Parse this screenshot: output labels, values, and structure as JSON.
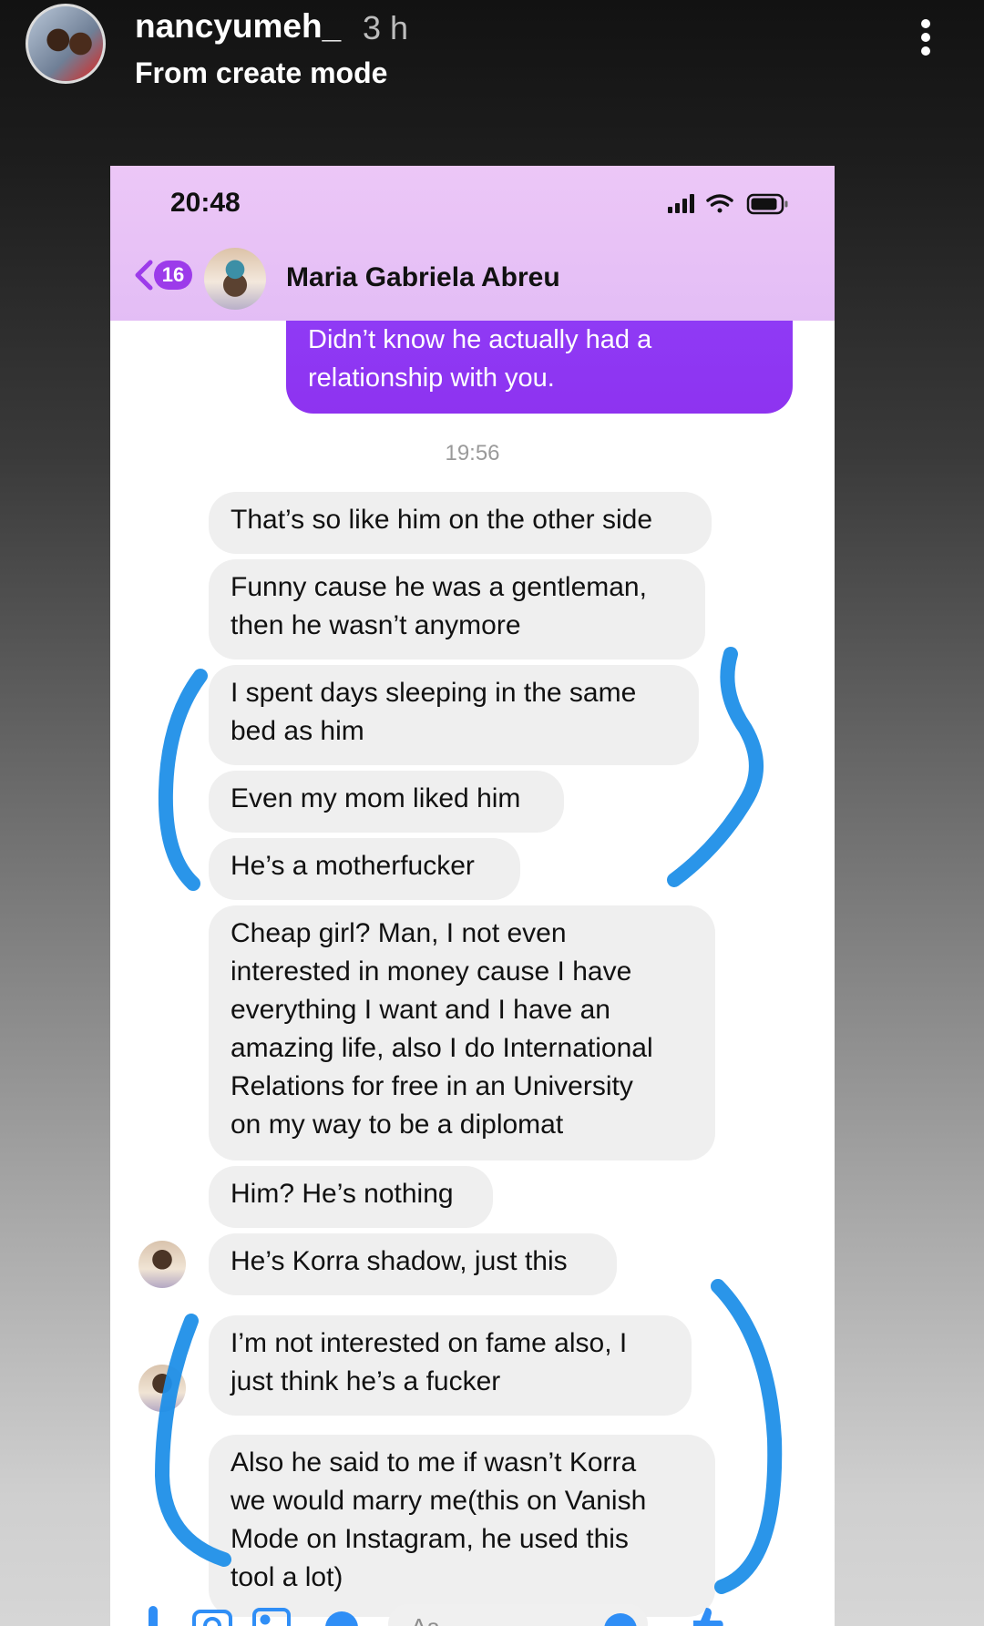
{
  "story": {
    "username": "nancyumeh_",
    "time": "3 h",
    "subtitle": "From create mode"
  },
  "phone": {
    "status_time": "20:48",
    "back_count": "16",
    "contact_name": "Maria Gabriela Abreu",
    "outgoing_message": [
      "Didn’t know he actually had a",
      "relationship with you."
    ],
    "timestamp": "19:56",
    "messages": [
      [
        "That’s so like him on the other side"
      ],
      [
        "Funny cause he was a gentleman,",
        "then he wasn’t anymore"
      ],
      [
        "I spent days sleeping in the same",
        "bed as him"
      ],
      [
        "Even my mom liked him"
      ],
      [
        "He’s a motherfucker"
      ],
      [
        "Cheap girl? Man, I not even",
        "interested in money cause I have",
        "everything I want and I have an",
        "amazing life, also I do International",
        "Relations for free in an University",
        "on my way to be a diplomat"
      ],
      [
        "Him? He’s nothing"
      ],
      [
        "He’s Korra shadow, just this"
      ],
      [
        "I’m not interested on fame also, I",
        "just think he’s a fucker"
      ],
      [
        "Also he said to me if wasn’t Korra",
        "we would marry me(this on Vanish",
        "Mode on Instagram, he used this",
        "tool a lot)"
      ]
    ],
    "composer_placeholder": "Aa"
  },
  "colors": {
    "header_tint": "#e7c1f6",
    "outgoing_bubble": "#8f35f2",
    "incoming_bubble": "#efefef",
    "badge": "#9c3bea",
    "annotation": "#1f8fe8"
  },
  "icons": [
    "more-vertical-icon",
    "signal-icon",
    "wifi-icon",
    "battery-icon",
    "back-chevron-icon",
    "mic-icon",
    "camera-icon",
    "image-icon",
    "sticker-icon",
    "emoji-icon",
    "like-icon"
  ]
}
